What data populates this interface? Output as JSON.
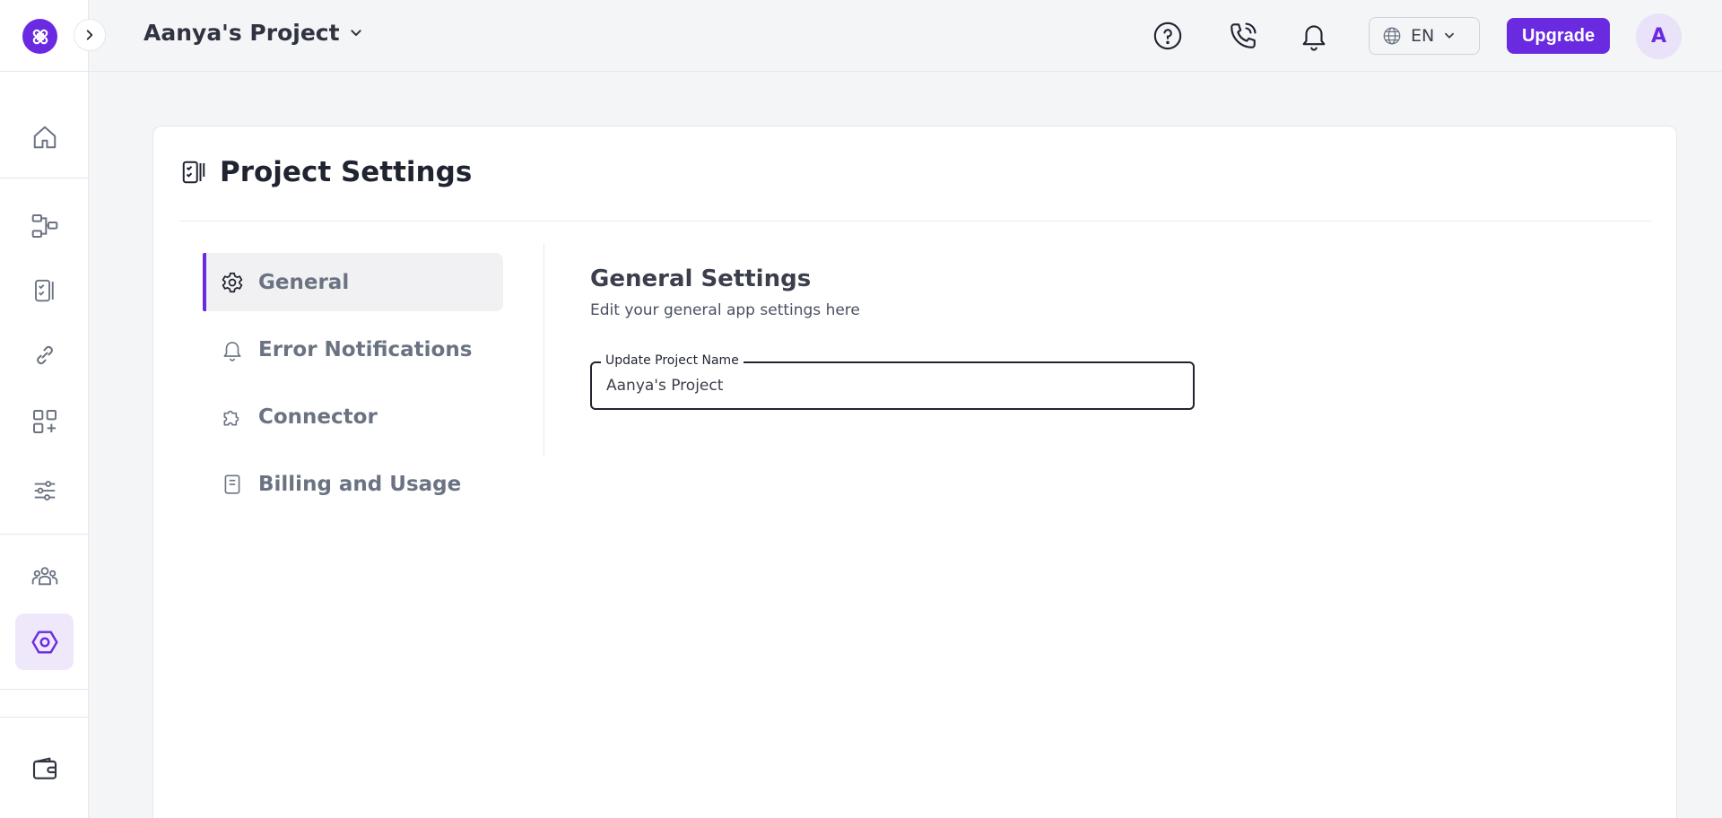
{
  "header": {
    "project_name": "Aanya's Project",
    "language": "EN",
    "upgrade_label": "Upgrade",
    "avatar_initial": "A",
    "icons": [
      "help-icon",
      "phone-icon",
      "bell-icon",
      "globe-icon"
    ]
  },
  "rail": {
    "items": [
      {
        "icon": "home-icon"
      },
      {
        "icon": "workflow-icon"
      },
      {
        "icon": "checklist-icon"
      },
      {
        "icon": "link-icon"
      },
      {
        "icon": "apps-add-icon"
      },
      {
        "icon": "sliders-icon"
      },
      {
        "icon": "team-icon"
      },
      {
        "icon": "hexagon-settings-icon",
        "active": true
      },
      {
        "icon": "wallet-icon"
      }
    ]
  },
  "page": {
    "title": "Project Settings",
    "subnav": [
      {
        "label": "General",
        "icon": "gear-icon",
        "active": true
      },
      {
        "label": "Error Notifications",
        "icon": "bell-icon"
      },
      {
        "label": "Connector",
        "icon": "puzzle-icon"
      },
      {
        "label": "Billing and Usage",
        "icon": "receipt-icon"
      }
    ],
    "settings": {
      "heading": "General Settings",
      "subheading": "Edit your general app settings here",
      "field_label": "Update Project Name",
      "field_value": "Aanya's Project"
    }
  },
  "colors": {
    "accent": "#6a2be0",
    "accent_light": "#efe8fb",
    "background": "#f4f5f7"
  }
}
